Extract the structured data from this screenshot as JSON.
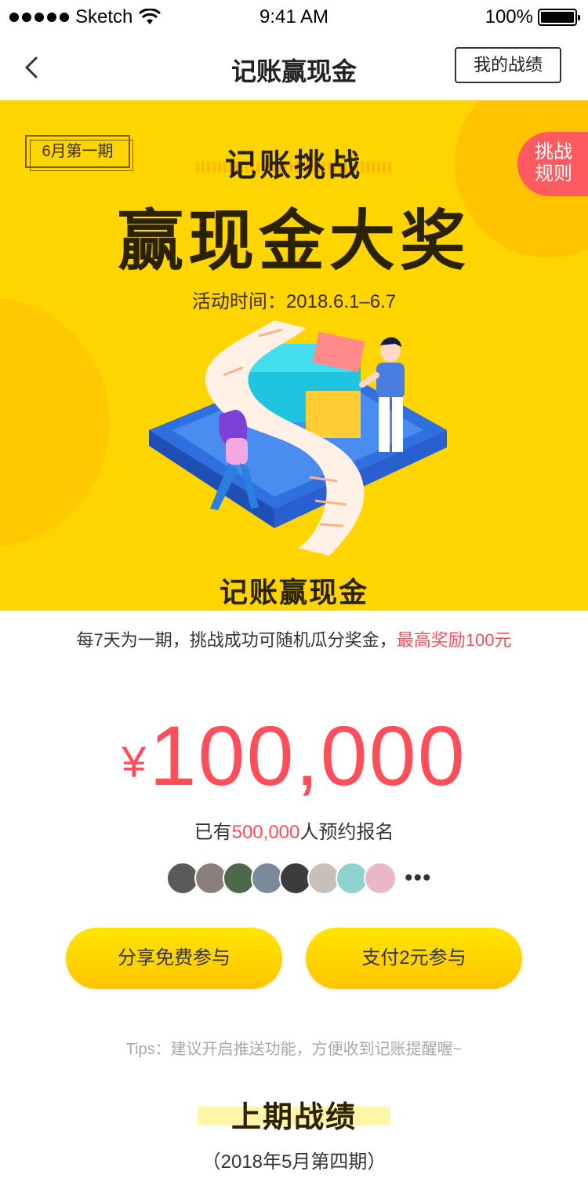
{
  "status_bar": {
    "carrier": "Sketch",
    "time": "9:41 AM",
    "battery": "100%"
  },
  "nav": {
    "title": "记账赢现金",
    "record_button": "我的战绩"
  },
  "banner": {
    "issue_tag": "6月第一期",
    "rules_line1": "挑战",
    "rules_line2": "规则",
    "challenge_title": "记账挑战",
    "main_title": "赢现金大奖",
    "date_line": "活动时间：2018.6.1–6.7",
    "subtitle": "记账赢现金"
  },
  "description": {
    "text": "每7天为一期，挑战成功可随机瓜分奖金，",
    "highlight": "最高奖励100元"
  },
  "prize": {
    "currency": "¥",
    "amount": "100,000"
  },
  "signup": {
    "prefix": "已有",
    "count": "500,000",
    "suffix": "人预约报名",
    "more": "•••"
  },
  "avatars": [
    {
      "color": "#5a5a5a"
    },
    {
      "color": "#8a7f7a"
    },
    {
      "color": "#4a6a4a"
    },
    {
      "color": "#7a8a9a"
    },
    {
      "color": "#3c3c3c"
    },
    {
      "color": "#c8c0b8"
    },
    {
      "color": "#8fd3d0"
    },
    {
      "color": "#e8b8c8"
    }
  ],
  "actions": {
    "share_label": "分享免费参与",
    "pay_label": "支付2元参与"
  },
  "tips": "Tips：建议开启推送功能，方便收到记账提醒喔~",
  "last_period": {
    "title": "上期战绩",
    "subtitle": "（2018年5月第四期）"
  },
  "colors": {
    "accent_yellow": "#ffd500",
    "accent_red": "#ff4d5a"
  }
}
